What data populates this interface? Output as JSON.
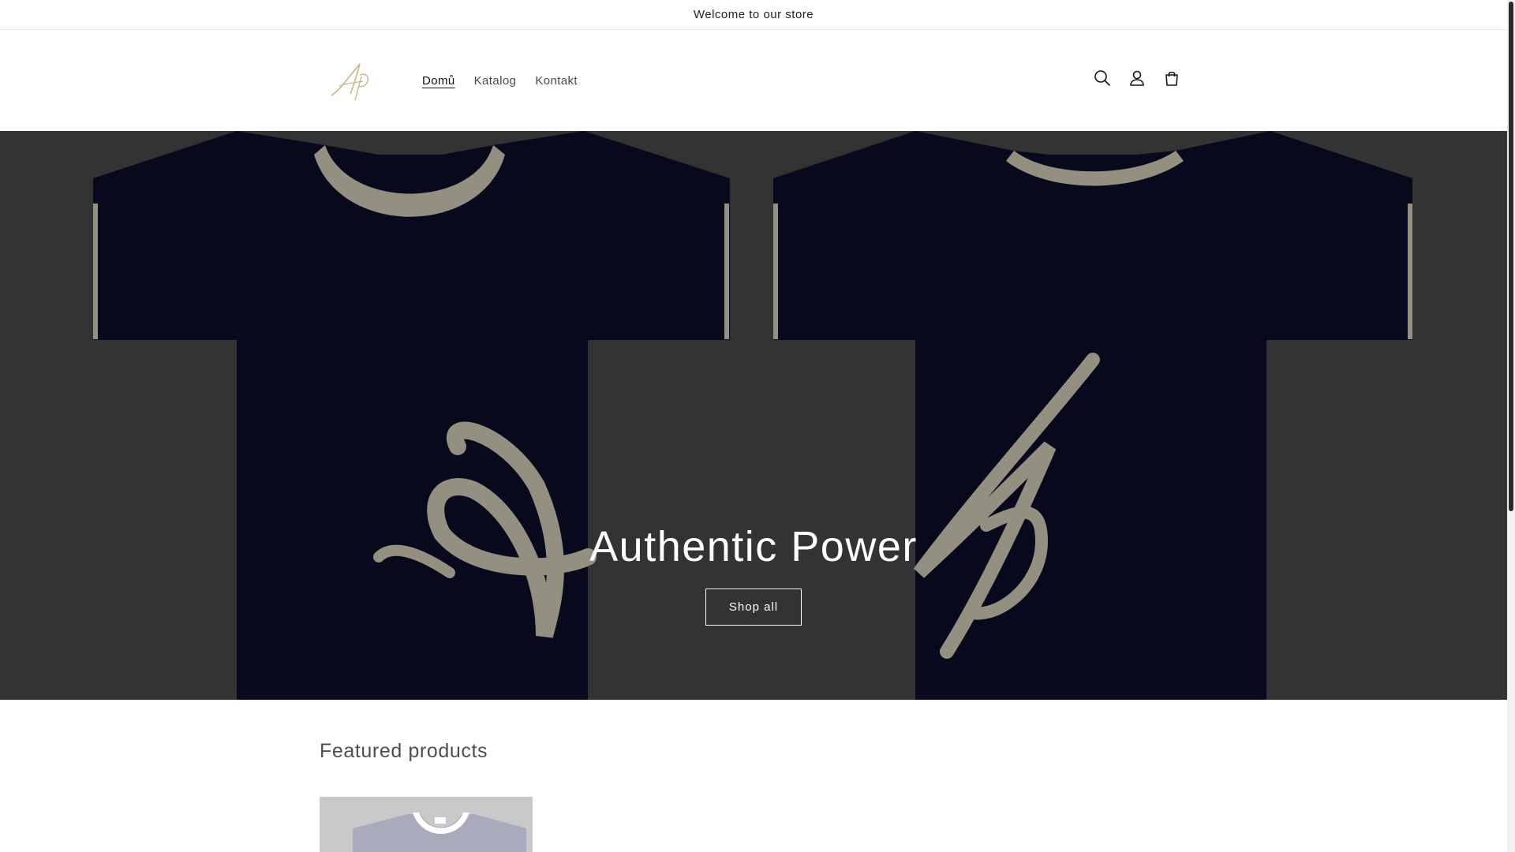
{
  "announcement": {
    "text": "Welcome to our store"
  },
  "header": {
    "logo_alt": "Ap",
    "nav": [
      {
        "label": "Domů",
        "active": true
      },
      {
        "label": "Katalog",
        "active": false
      },
      {
        "label": "Kontakt",
        "active": false
      }
    ],
    "icons": [
      "search-icon",
      "account-icon",
      "cart-icon"
    ]
  },
  "hero": {
    "title": "Authentic Power",
    "button_label": "Shop all"
  },
  "featured": {
    "title": "Featured products"
  },
  "colors": {
    "hero_overlay": "#3b3b3b",
    "shirt": "#0b0b22",
    "trim": "#a8a393",
    "logo_gold": "#c9b48a"
  }
}
